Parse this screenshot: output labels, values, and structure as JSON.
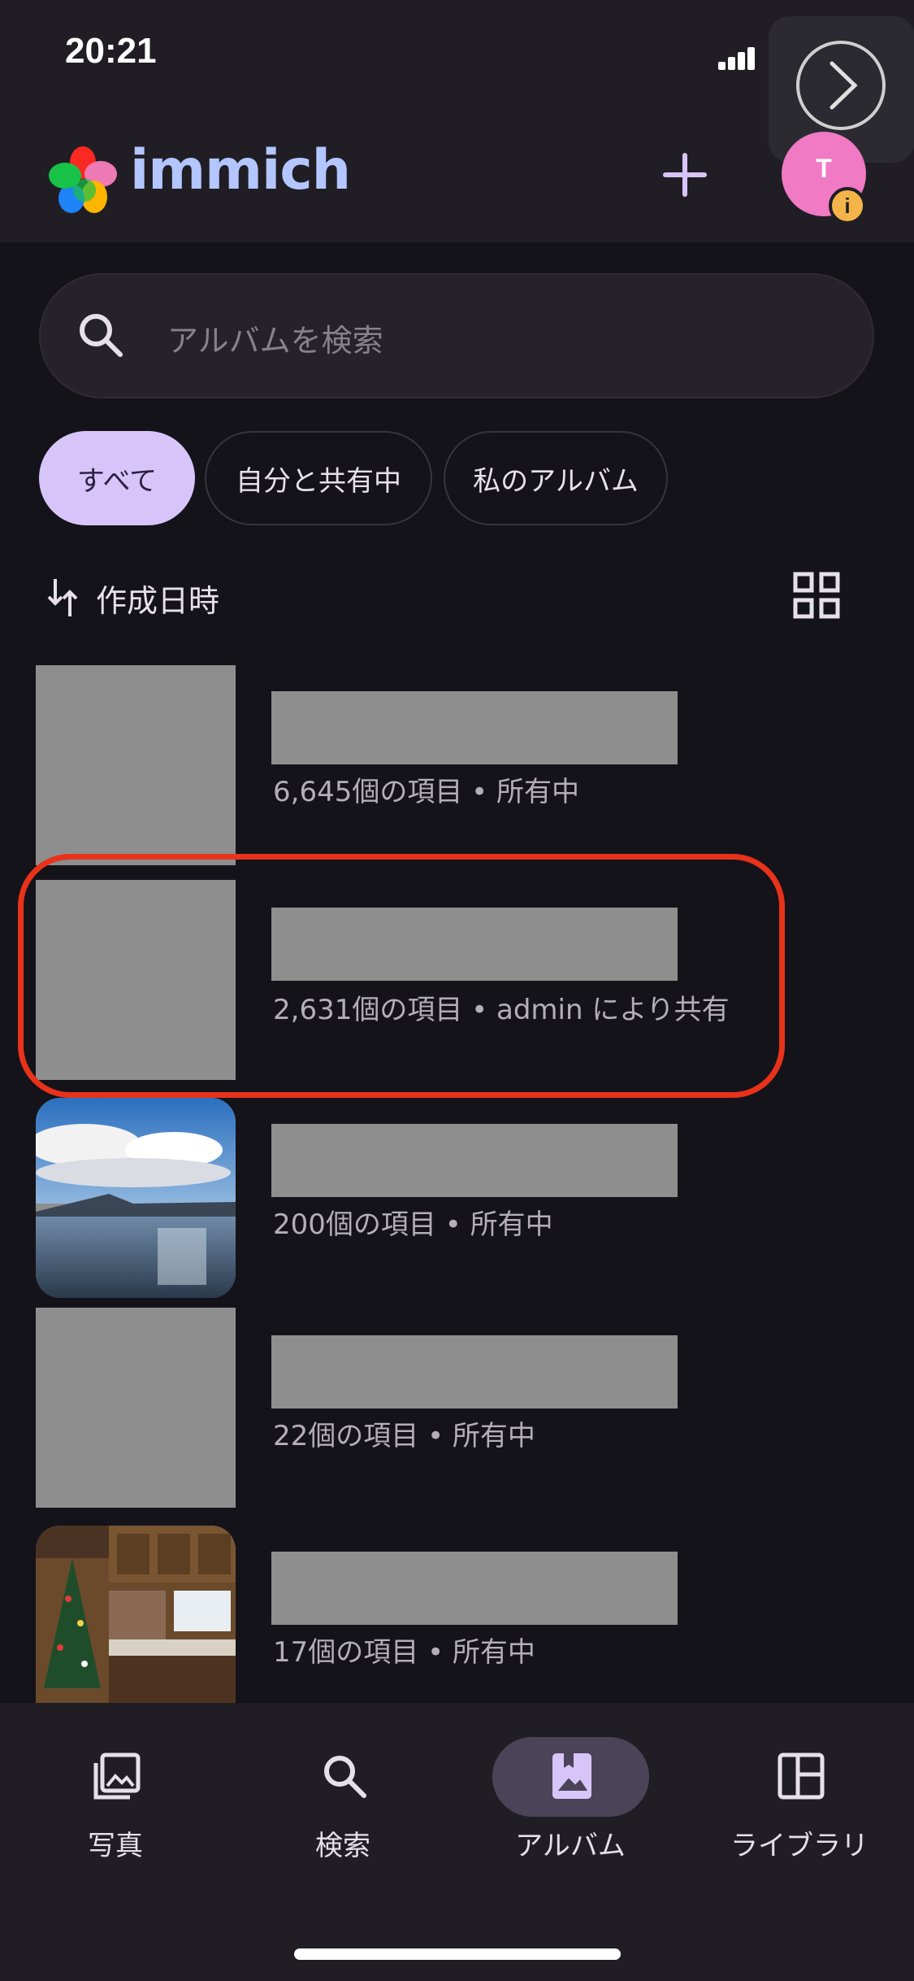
{
  "status_bar": {
    "time": "20:21"
  },
  "header": {
    "brand": "immich",
    "avatar_initial": "T",
    "avatar_badge": "i"
  },
  "search": {
    "placeholder": "アルバムを検索"
  },
  "filters": [
    {
      "label": "すべて",
      "active": true
    },
    {
      "label": "自分と共有中",
      "active": false
    },
    {
      "label": "私のアルバム",
      "active": false
    }
  ],
  "sort": {
    "label": "作成日時"
  },
  "albums": [
    {
      "subtitle": "6,645個の項目 • 所有中",
      "thumbnail": "placeholder"
    },
    {
      "subtitle": "2,631個の項目 • admin により共有",
      "thumbnail": "placeholder"
    },
    {
      "subtitle": "200個の項目 • 所有中",
      "thumbnail": "lake-landscape"
    },
    {
      "subtitle": "22個の項目 • 所有中",
      "thumbnail": "placeholder"
    },
    {
      "subtitle": "17個の項目 • 所有中",
      "thumbnail": "christmas-kitchen"
    }
  ],
  "bottom_nav": [
    {
      "label": "写真",
      "icon": "photos-icon"
    },
    {
      "label": "検索",
      "icon": "search-icon"
    },
    {
      "label": "アルバム",
      "icon": "album-icon",
      "active": true
    },
    {
      "label": "ライブラリ",
      "icon": "library-icon"
    }
  ],
  "colors": {
    "background": "#15131a",
    "accent": "#d7c5fa",
    "brand_text": "#b3c6ff",
    "highlight": "#e8321a"
  }
}
